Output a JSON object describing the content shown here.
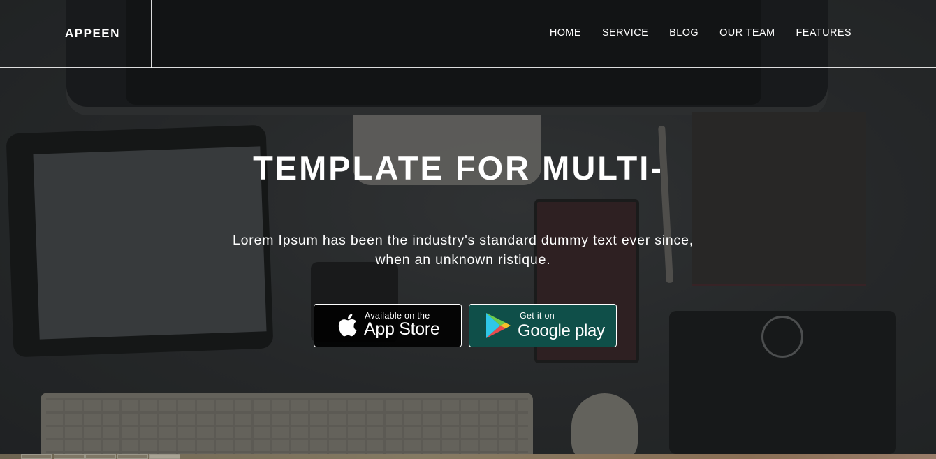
{
  "brand": {
    "logo": "APPEEN"
  },
  "nav": {
    "items": [
      {
        "label": "HOME"
      },
      {
        "label": "SERVICE"
      },
      {
        "label": "BLOG"
      },
      {
        "label": "OUR TEAM"
      },
      {
        "label": "FEATURES"
      }
    ]
  },
  "hero": {
    "title": "TEMPLATE FOR MULTI-",
    "subtitle_line1": "Lorem Ipsum has been the industry's standard dummy text ever since,",
    "subtitle_line2": "when an unknown ristique."
  },
  "buttons": {
    "app_store": {
      "small": "Available on the",
      "big": "App Store",
      "icon": "apple-icon"
    },
    "google_play": {
      "small": "Get it on",
      "big": "Google play",
      "icon": "google-play-icon"
    }
  },
  "colors": {
    "google_button_bg": "#0f4f49",
    "apple_button_bg": "#000000",
    "text": "#ffffff"
  }
}
